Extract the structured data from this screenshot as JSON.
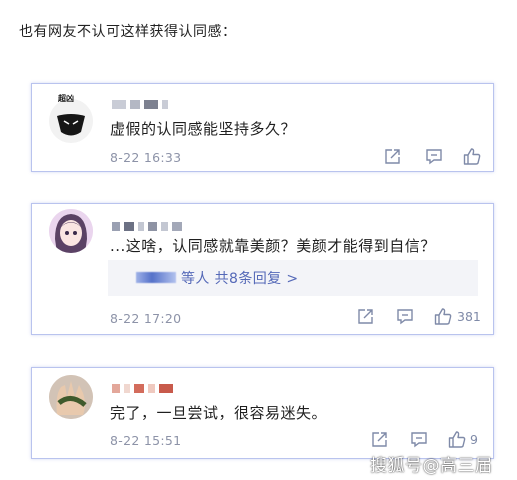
{
  "intro": "也有网友不认可这样获得认同感：",
  "comments": [
    {
      "avatar_badge": "超凶",
      "text": "虚假的认同感能坚持多久？",
      "date": "8-22 16:33",
      "like_count": ""
    },
    {
      "text": "...这啥，认同感就靠美颜？美颜才能得到自信？",
      "replies_text": "等人  共8条回复 >",
      "date": "8-22 17:20",
      "like_count": "381"
    },
    {
      "text": "完了，一旦尝试，很容易迷失。",
      "date": "8-22 15:51",
      "like_count": "9"
    }
  ],
  "watermark": "搜狐号@高三届",
  "colors": {
    "card_border": "#b9c3ee",
    "date": "#8d93a8",
    "icon": "#7f8aa8",
    "link": "#5569b8"
  },
  "icons": [
    "share-icon",
    "reply-icon",
    "like-icon"
  ]
}
